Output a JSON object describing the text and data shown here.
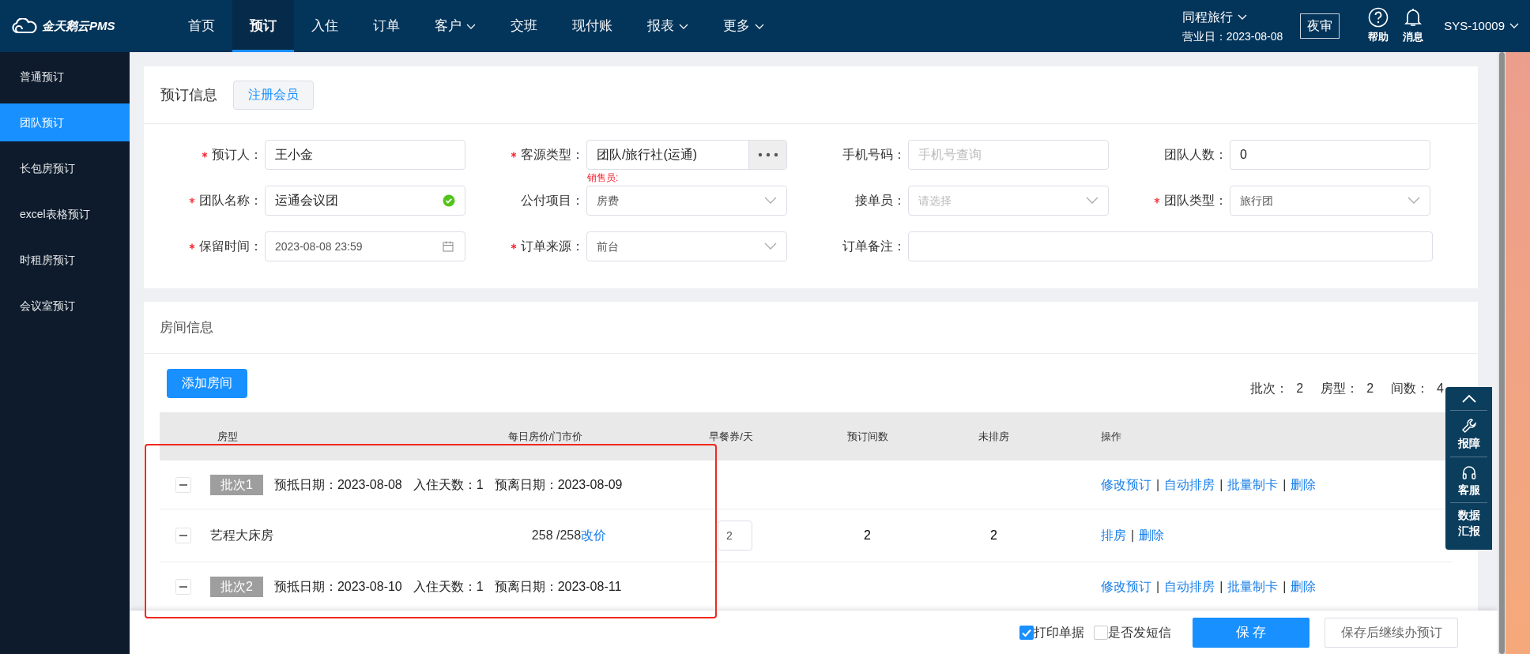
{
  "logo": {
    "text": "金天鹅云PMS"
  },
  "nav": [
    {
      "label": "首页",
      "selected": false,
      "dropdown": false
    },
    {
      "label": "预订",
      "selected": true,
      "dropdown": false
    },
    {
      "label": "入住",
      "selected": false,
      "dropdown": false
    },
    {
      "label": "订单",
      "selected": false,
      "dropdown": false
    },
    {
      "label": "客户",
      "selected": false,
      "dropdown": true
    },
    {
      "label": "交班",
      "selected": false,
      "dropdown": false
    },
    {
      "label": "现付账",
      "selected": false,
      "dropdown": false
    },
    {
      "label": "报表",
      "selected": false,
      "dropdown": true
    },
    {
      "label": "更多",
      "selected": false,
      "dropdown": true
    }
  ],
  "hotel": {
    "name": "同程旅行",
    "business_day": "营业日：2023-08-08"
  },
  "night_audit": "夜审",
  "header_tools": [
    {
      "kind": "help",
      "label": "帮助"
    },
    {
      "kind": "bell",
      "label": "消息"
    }
  ],
  "user": "SYS-10009",
  "sidebar": [
    {
      "label": "普通预订",
      "selected": false
    },
    {
      "label": "团队预订",
      "selected": true
    },
    {
      "label": "长包房预订",
      "selected": false
    },
    {
      "label": "excel表格预订",
      "selected": false
    },
    {
      "label": "时租房预订",
      "selected": false
    },
    {
      "label": "会议室预订",
      "selected": false
    }
  ],
  "booking": {
    "title": "预订信息",
    "register_button": "注册会员",
    "rows": [
      [
        {
          "label": "预订人：",
          "required": true,
          "kind": "text",
          "value": "王小金"
        },
        {
          "label": "客源类型：",
          "required": true,
          "kind": "lookup",
          "value": "团队/旅行社(运通)",
          "hint": "销售员:"
        },
        {
          "label": "手机号码：",
          "required": false,
          "kind": "text",
          "placeholder": "手机号查询"
        },
        {
          "label": "团队人数：",
          "required": false,
          "kind": "text",
          "value": "0"
        }
      ],
      [
        {
          "label": "团队名称：",
          "required": true,
          "kind": "text",
          "value": "运通会议团",
          "valid": true
        },
        {
          "label": "公付项目：",
          "required": false,
          "kind": "select",
          "value": "房费"
        },
        {
          "label": "接单员：",
          "required": false,
          "kind": "select",
          "placeholder": "请选择"
        },
        {
          "label": "团队类型：",
          "required": true,
          "kind": "select",
          "value": "旅行团"
        }
      ],
      [
        {
          "label": "保留时间：",
          "required": true,
          "kind": "date",
          "value": "2023-08-08 23:59"
        },
        {
          "label": "订单来源：",
          "required": true,
          "kind": "select",
          "value": "前台"
        },
        {
          "label": "订单备注：",
          "required": false,
          "kind": "wide"
        }
      ]
    ]
  },
  "rooms": {
    "title": "房间信息",
    "add_button": "添加房间",
    "summary": [
      {
        "label": "批次：",
        "value": "2"
      },
      {
        "label": "房型：",
        "value": "2"
      },
      {
        "label": "间数：",
        "value": "4"
      }
    ],
    "columns": [
      "房型",
      "每日房价/门市价",
      "早餐券/天",
      "预订间数",
      "未排房",
      "操作"
    ],
    "rows": [
      {
        "kind": "batch",
        "tag": "批次1",
        "details": [
          "预抵日期：2023-08-08",
          "入住天数：1",
          "预离日期：2023-08-09"
        ],
        "actions": [
          {
            "kind": "link",
            "label": "修改预订"
          },
          {
            "kind": "sep",
            "label": "|"
          },
          {
            "kind": "link",
            "label": "自动排房"
          },
          {
            "kind": "sep",
            "label": "|"
          },
          {
            "kind": "link",
            "label": "批量制卡"
          },
          {
            "kind": "sep",
            "label": "|"
          },
          {
            "kind": "link",
            "label": "删除"
          }
        ]
      },
      {
        "kind": "room",
        "room_type": "艺程大床房",
        "price": "258 /258",
        "price_link": "改价",
        "breakfast": "2",
        "booked": "2",
        "unassigned": "2",
        "actions": [
          {
            "kind": "link",
            "label": "排房"
          },
          {
            "kind": "sep",
            "label": "|"
          },
          {
            "kind": "link",
            "label": "删除"
          }
        ]
      },
      {
        "kind": "batch",
        "tag": "批次2",
        "details": [
          "预抵日期：2023-08-10",
          "入住天数：1",
          "预离日期：2023-08-11"
        ],
        "actions": [
          {
            "kind": "link",
            "label": "修改预订"
          },
          {
            "kind": "sep",
            "label": "|"
          },
          {
            "kind": "link",
            "label": "自动排房"
          },
          {
            "kind": "sep",
            "label": "|"
          },
          {
            "kind": "link",
            "label": "批量制卡"
          },
          {
            "kind": "sep",
            "label": "|"
          },
          {
            "kind": "link",
            "label": "删除"
          }
        ]
      }
    ]
  },
  "footer": {
    "checkboxes": [
      {
        "label": "打印单据",
        "checked": true
      },
      {
        "label": "是否发短信",
        "checked": false
      }
    ],
    "buttons": [
      {
        "kind": "primary",
        "label": "保 存"
      },
      {
        "kind": "default",
        "label": "保存后继续办预订"
      }
    ]
  },
  "float_panel": [
    {
      "kind": "up"
    },
    {
      "kind": "wrench",
      "label": "报障"
    },
    {
      "kind": "headset",
      "label": "客服"
    },
    {
      "kind": "text",
      "label": "数据汇报"
    }
  ]
}
